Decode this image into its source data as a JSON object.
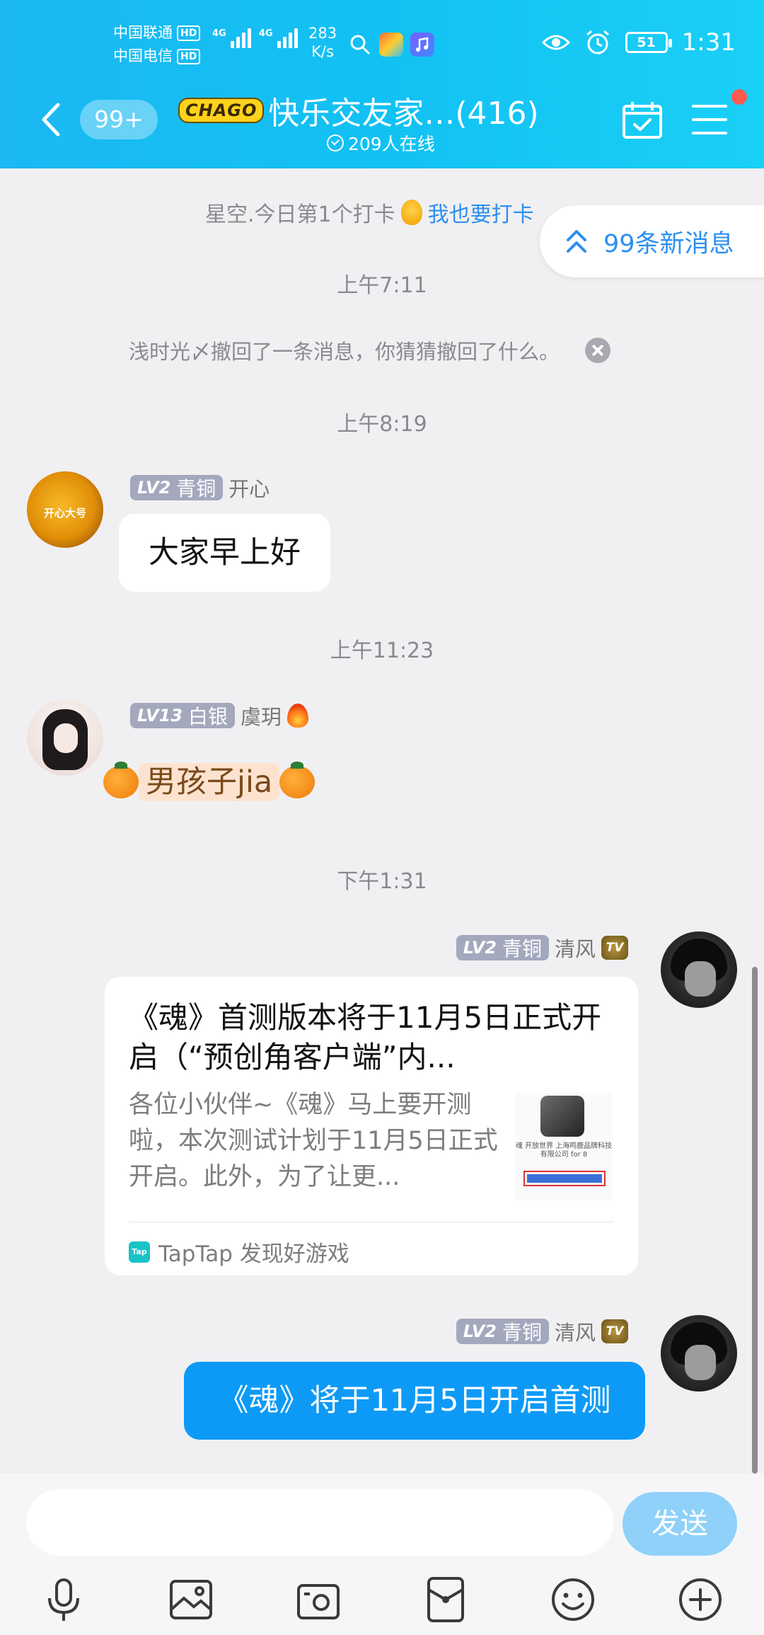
{
  "status_bar": {
    "carrier_1": "中国联通",
    "carrier_2": "中国电信",
    "hd_label": "HD",
    "net_1": "4G",
    "net_2": "4G",
    "speed_value": "283",
    "speed_unit": "K/s",
    "battery": "51",
    "time": "1:31"
  },
  "header": {
    "unread_badge": "99+",
    "logo_text": "CHAGO",
    "group_title": "快乐交友家…(416)",
    "online_count": "209人在线"
  },
  "checkin": {
    "text": "星空.今日第1个打卡",
    "link": "我也要打卡"
  },
  "new_messages": {
    "label": "99条新消息"
  },
  "messages": {
    "time_1": "上午7:11",
    "recall_notice": "浅时光〆撤回了一条消息，你猜猜撤回了什么。",
    "time_2": "上午8:19",
    "msg1": {
      "level": "LV2",
      "rank": "青铜",
      "sender": "开心",
      "avatar_caption": "开心大号",
      "text": "大家早上好"
    },
    "time_3": "上午11:23",
    "msg2": {
      "level": "LV13",
      "rank": "白银",
      "sender": "虞玥",
      "text": "男孩子jia"
    },
    "time_4": "下午1:31",
    "msg3": {
      "level": "LV2",
      "rank": "青铜",
      "sender": "清风",
      "badge": "TV",
      "card_title": "《魂》首测版本将于11月5日正式开启（“预创角客户端”内...",
      "card_desc": "各位小伙伴~《魂》马上要开测啦，本次测试计划于11月5日正式开启。此外，为了让更...",
      "thumb_text": "魂 开放世界 上海鸣鹿品牌科技有限公司 for 8",
      "source_icon": "Tap",
      "source": "TapTap 发现好游戏"
    },
    "msg4": {
      "level": "LV2",
      "rank": "青铜",
      "sender": "清风",
      "badge": "TV",
      "text": "《魂》将于11月5日开启首测"
    }
  },
  "composer": {
    "placeholder": "",
    "send_label": "发送"
  },
  "colors": {
    "header_gradient_start": "#1bb8f3",
    "header_gradient_end": "#1ad0f6",
    "accent_blue": "#2c8ff0",
    "own_bubble": "#0d9af6",
    "send_button": "#8fd1f9",
    "level_tag": "#a4a8bd"
  },
  "icons": [
    "back-icon",
    "calendar-check-icon",
    "menu-icon",
    "double-chevron-up-icon",
    "close-icon",
    "mic-icon",
    "image-icon",
    "camera-icon",
    "red-packet-icon",
    "emoji-icon",
    "plus-icon"
  ]
}
